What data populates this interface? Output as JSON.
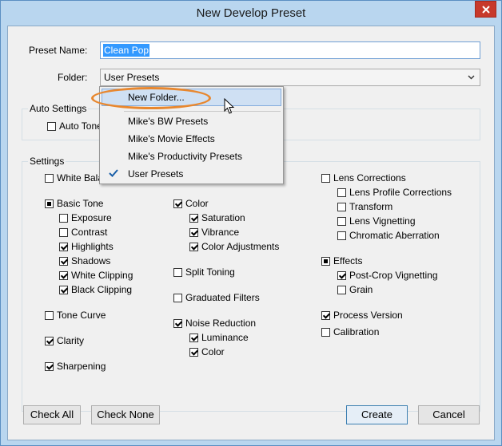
{
  "window": {
    "title": "New Develop Preset"
  },
  "preset_name": {
    "label": "Preset Name:",
    "value": "Clean Pop"
  },
  "folder": {
    "label": "Folder:",
    "value": "User Presets"
  },
  "auto_settings": {
    "title": "Auto Settings",
    "auto_tone": {
      "label": "Auto Tone",
      "checked": false
    }
  },
  "settings": {
    "title": "Settings",
    "col1": [
      {
        "label": "White Balance",
        "state": "unchecked"
      },
      {
        "label": "Basic Tone",
        "state": "mixed"
      },
      {
        "label": "Exposure",
        "state": "unchecked"
      },
      {
        "label": "Contrast",
        "state": "unchecked"
      },
      {
        "label": "Highlights",
        "state": "checked"
      },
      {
        "label": "Shadows",
        "state": "checked"
      },
      {
        "label": "White Clipping",
        "state": "checked"
      },
      {
        "label": "Black Clipping",
        "state": "checked"
      },
      {
        "label": "Tone Curve",
        "state": "unchecked"
      },
      {
        "label": "Clarity",
        "state": "checked"
      },
      {
        "label": "Sharpening",
        "state": "checked"
      }
    ],
    "col2": [
      {
        "label": "Color",
        "state": "checked"
      },
      {
        "label": "Saturation",
        "state": "checked"
      },
      {
        "label": "Vibrance",
        "state": "checked"
      },
      {
        "label": "Color Adjustments",
        "state": "checked"
      },
      {
        "label": "Split Toning",
        "state": "unchecked"
      },
      {
        "label": "Graduated Filters",
        "state": "unchecked"
      },
      {
        "label": "Noise Reduction",
        "state": "checked"
      },
      {
        "label": "Luminance",
        "state": "checked"
      },
      {
        "label": "Color",
        "state": "checked"
      }
    ],
    "col3": [
      {
        "label": "Lens Corrections",
        "state": "unchecked"
      },
      {
        "label": "Lens Profile Corrections",
        "state": "unchecked"
      },
      {
        "label": "Transform",
        "state": "unchecked"
      },
      {
        "label": "Lens Vignetting",
        "state": "unchecked"
      },
      {
        "label": "Chromatic Aberration",
        "state": "unchecked"
      },
      {
        "label": "Effects",
        "state": "mixed"
      },
      {
        "label": "Post-Crop Vignetting",
        "state": "checked"
      },
      {
        "label": "Grain",
        "state": "unchecked"
      },
      {
        "label": "Process Version",
        "state": "checked"
      },
      {
        "label": "Calibration",
        "state": "unchecked"
      }
    ]
  },
  "buttons": {
    "check_all": "Check All",
    "check_none": "Check None",
    "create": "Create",
    "cancel": "Cancel"
  },
  "dropdown_menu": {
    "items": [
      {
        "label": "New Folder...",
        "highlighted": true,
        "checked": false
      },
      {
        "label": "Mike's BW Presets",
        "highlighted": false,
        "checked": false
      },
      {
        "label": "Mike's Movie Effects",
        "highlighted": false,
        "checked": false
      },
      {
        "label": "Mike's Productivity Presets",
        "highlighted": false,
        "checked": false
      },
      {
        "label": "User Presets",
        "highlighted": false,
        "checked": true
      }
    ],
    "annotation_color": "#e8872e"
  },
  "colors": {
    "titlebar": "#b9d6ef",
    "close_button": "#c7392b",
    "selection": "#3399ff"
  }
}
